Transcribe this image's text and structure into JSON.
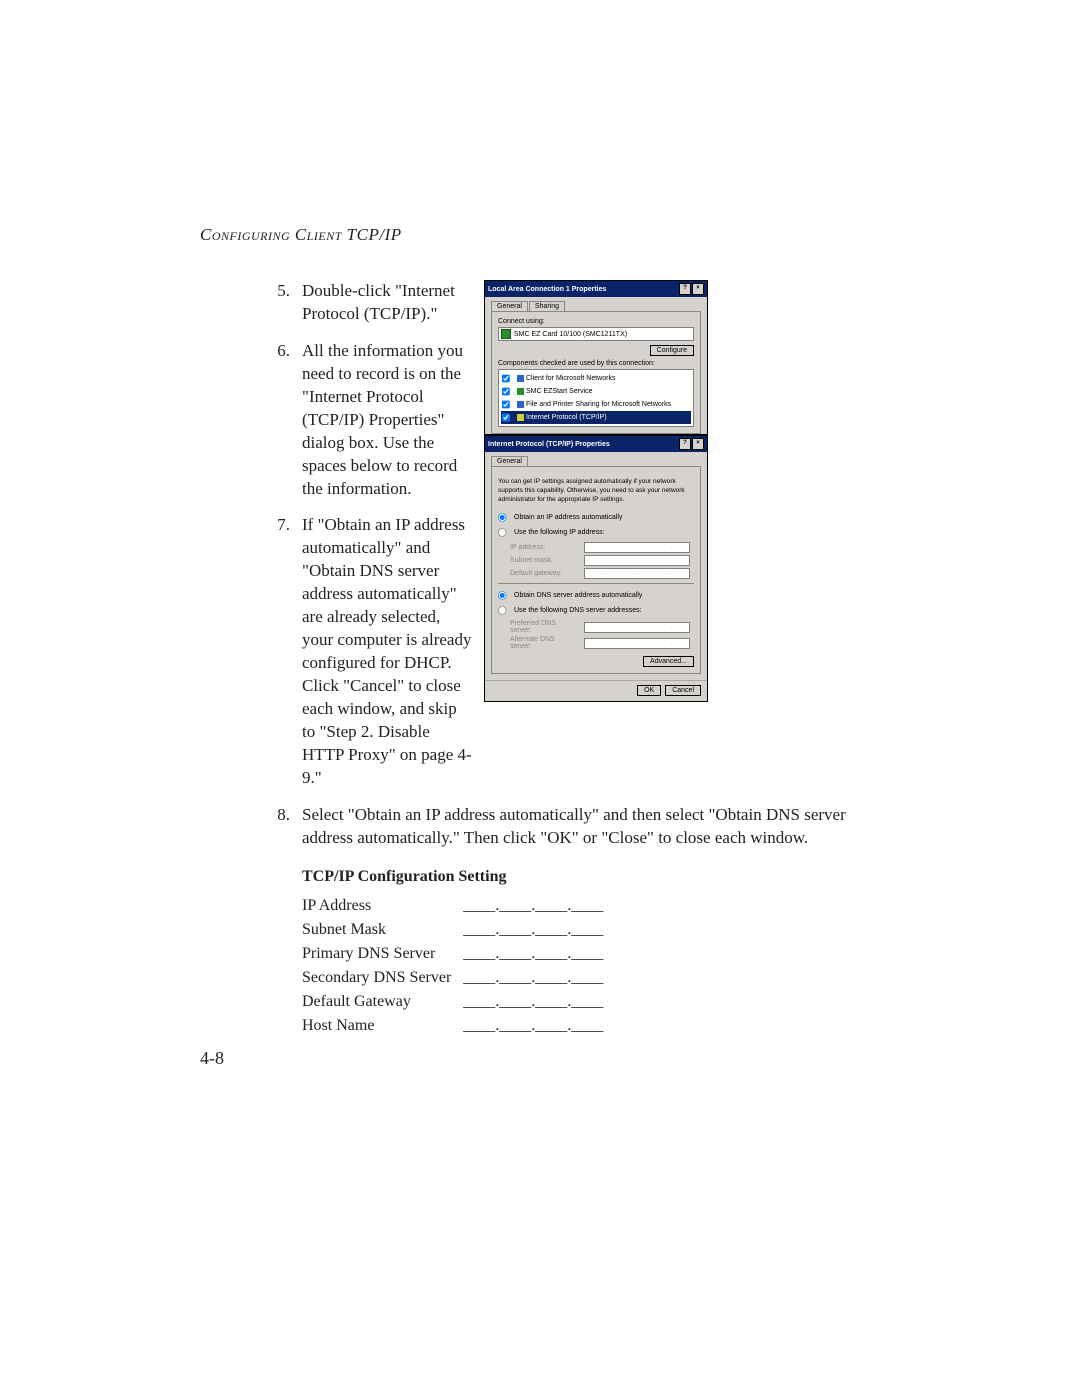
{
  "header": "Configuring Client TCP/IP",
  "page_number": "4-8",
  "steps": [
    {
      "n": "5.",
      "text": "Double-click \"Internet Protocol (TCP/IP).\""
    },
    {
      "n": "6.",
      "text": "All the information you need to record is on the \"Internet Protocol (TCP/IP) Properties\" dialog box. Use the spaces below to record the information."
    },
    {
      "n": "7.",
      "text": "If \"Obtain an IP address automatically\" and \"Obtain DNS server address automatically\" are already selected, your computer is already configured for DHCP. Click \"Cancel\" to close each window, and skip to \"Step 2. Disable HTTP Proxy\" on page 4-9.\""
    },
    {
      "n": "8.",
      "text": "Select \"Obtain an IP address automatically\" and then select \"Obtain DNS server address automatically.\" Then click \"OK\" or \"Close\" to close each window."
    }
  ],
  "cfg_heading": "TCP/IP Configuration Setting",
  "cfg_rows": [
    "IP Address",
    "Subnet Mask",
    "Primary DNS Server",
    "Secondary DNS Server",
    "Default Gateway",
    "Host Name"
  ],
  "blank_cell": "____.____.____.____",
  "dlg1": {
    "title": "Local Area Connection 1 Properties",
    "tab_general": "General",
    "tab_sharing": "Sharing",
    "connect_using": "Connect using:",
    "nic": "SMC EZ Card 10/100 (SMC1211TX)",
    "configure": "Configure",
    "components_lbl": "Components checked are used by this connection:",
    "items": [
      "Client for Microsoft Networks",
      "SMC EZStart Service",
      "File and Printer Sharing for Microsoft Networks",
      "Internet Protocol (TCP/IP)"
    ]
  },
  "dlg2": {
    "title": "Internet Protocol (TCP/IP) Properties",
    "tab_general": "General",
    "help": "You can get IP settings assigned automatically if your network supports this capability. Otherwise, you need to ask your network administrator for the appropriate IP settings.",
    "opt_auto_ip": "Obtain an IP address automatically",
    "opt_use_ip": "Use the following IP address:",
    "ip_address": "IP address:",
    "subnet": "Subnet mask:",
    "gateway": "Default gateway:",
    "opt_auto_dns": "Obtain DNS server address automatically",
    "opt_use_dns": "Use the following DNS server addresses:",
    "pref_dns": "Preferred DNS server:",
    "alt_dns": "Alternate DNS server:",
    "advanced": "Advanced...",
    "ok": "OK",
    "cancel": "Cancel"
  }
}
